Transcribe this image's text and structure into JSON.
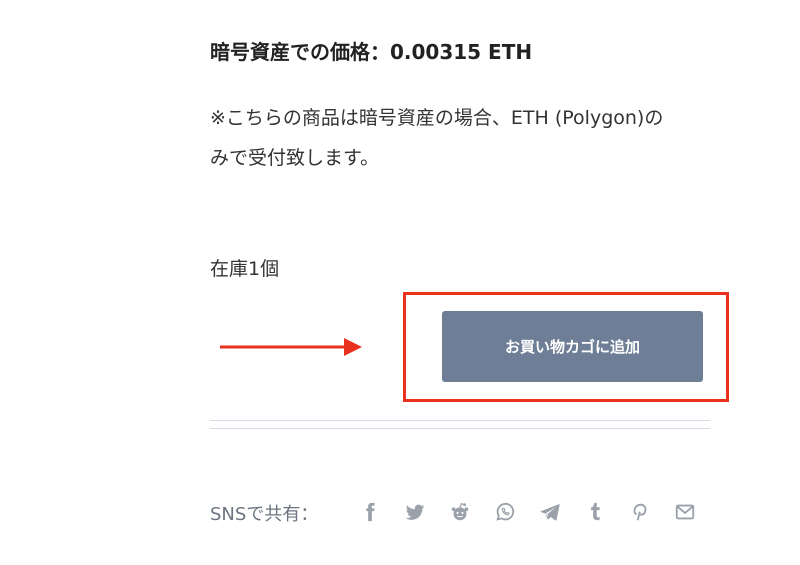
{
  "product": {
    "crypto_price": "暗号資産での価格：0.00315 ETH",
    "payment_note": "※こちらの商品は暗号資産の場合、ETH (Polygon)のみで受付致します。",
    "stock": "在庫1個"
  },
  "cart": {
    "add_button_label": "お買い物カゴに追加"
  },
  "share": {
    "label": "SNSで共有：",
    "icons": [
      "facebook-icon",
      "twitter-icon",
      "reddit-icon",
      "whatsapp-icon",
      "telegram-icon",
      "tumblr-icon",
      "pinterest-icon",
      "email-icon"
    ]
  },
  "colors": {
    "button_bg": "#6e7e96",
    "highlight_red": "#e8321f",
    "share_icon": "#9aa1aa",
    "divider": "#d3dbe6"
  }
}
